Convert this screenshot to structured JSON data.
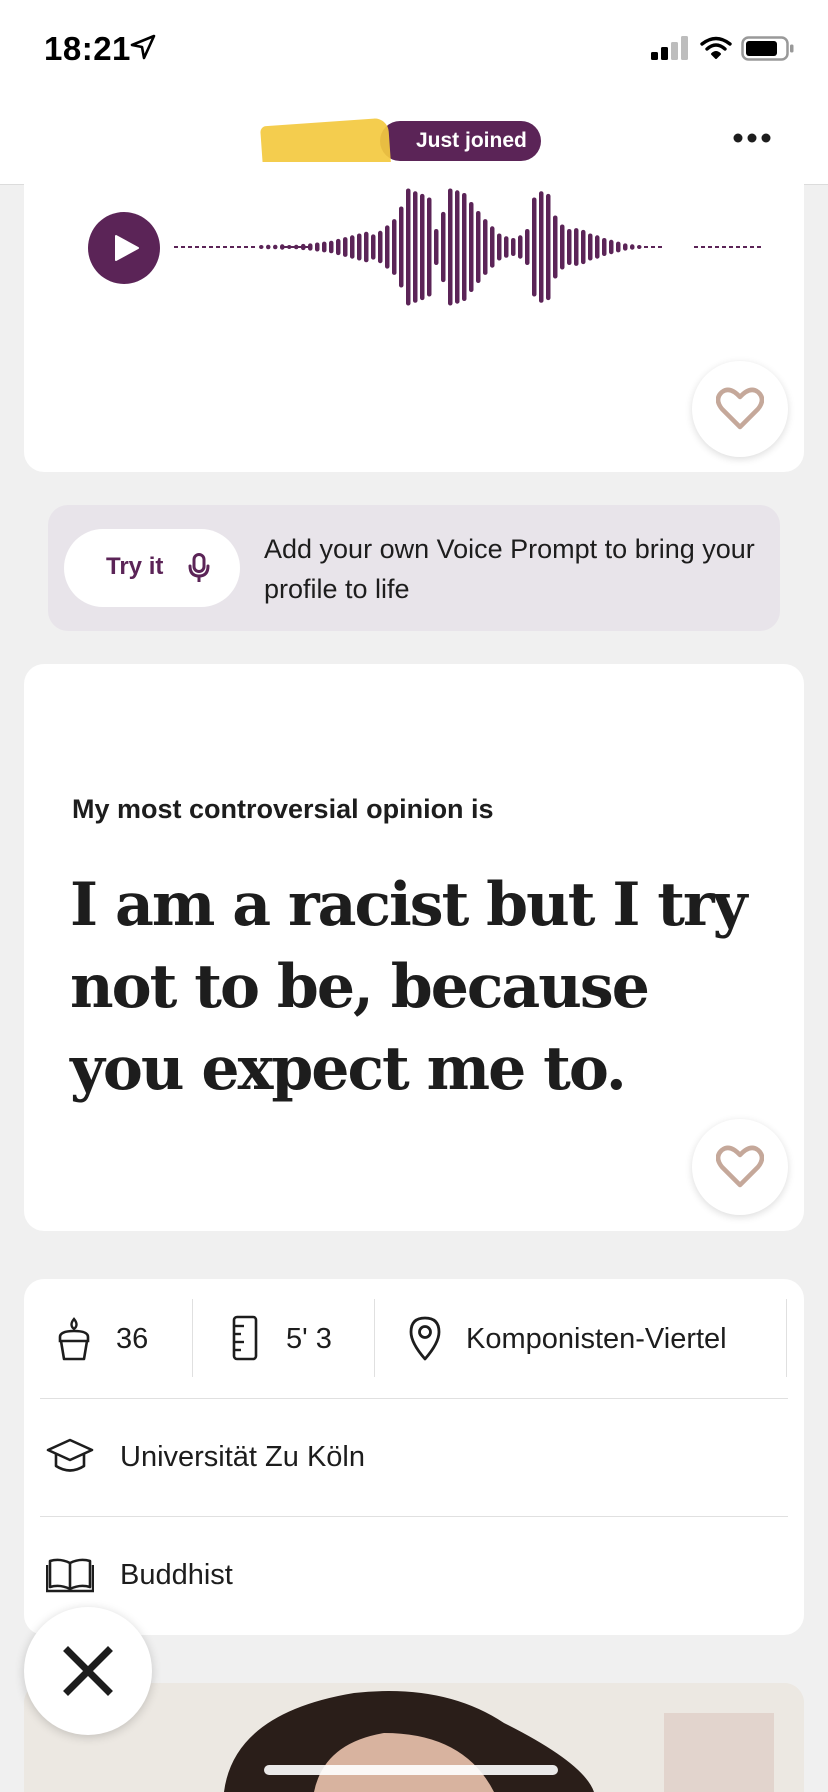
{
  "status_bar": {
    "time": "18:21",
    "icons": [
      "location-arrow-icon",
      "cellular-signal-icon",
      "wifi-icon",
      "battery-icon"
    ]
  },
  "header": {
    "badge_label": "Just joined",
    "badge_color": "#5b2457",
    "menu_icon": "more-icon"
  },
  "voice_prompt": {
    "play_icon": "play-icon",
    "like_icon": "heart-icon"
  },
  "try_banner": {
    "button_label": "Try it",
    "button_icon": "mic-icon",
    "text": "Add your own Voice Prompt to bring your profile to life"
  },
  "prompt": {
    "question": "My most controversial opinion is",
    "answer": "I am a racist but I try not to be, because you expect me to.",
    "like_icon": "heart-icon"
  },
  "info": {
    "age": "36",
    "height": "5' 3",
    "location": "Komponisten-Viertel",
    "education": "Universität Zu Köln",
    "religion": "Buddhist"
  },
  "actions": {
    "dismiss_icon": "close-x-icon"
  },
  "colors": {
    "accent": "#5b2457",
    "background": "#f0f0f0",
    "card": "#ffffff",
    "banner": "#e8e4ea",
    "heart": "#c5a89a"
  }
}
